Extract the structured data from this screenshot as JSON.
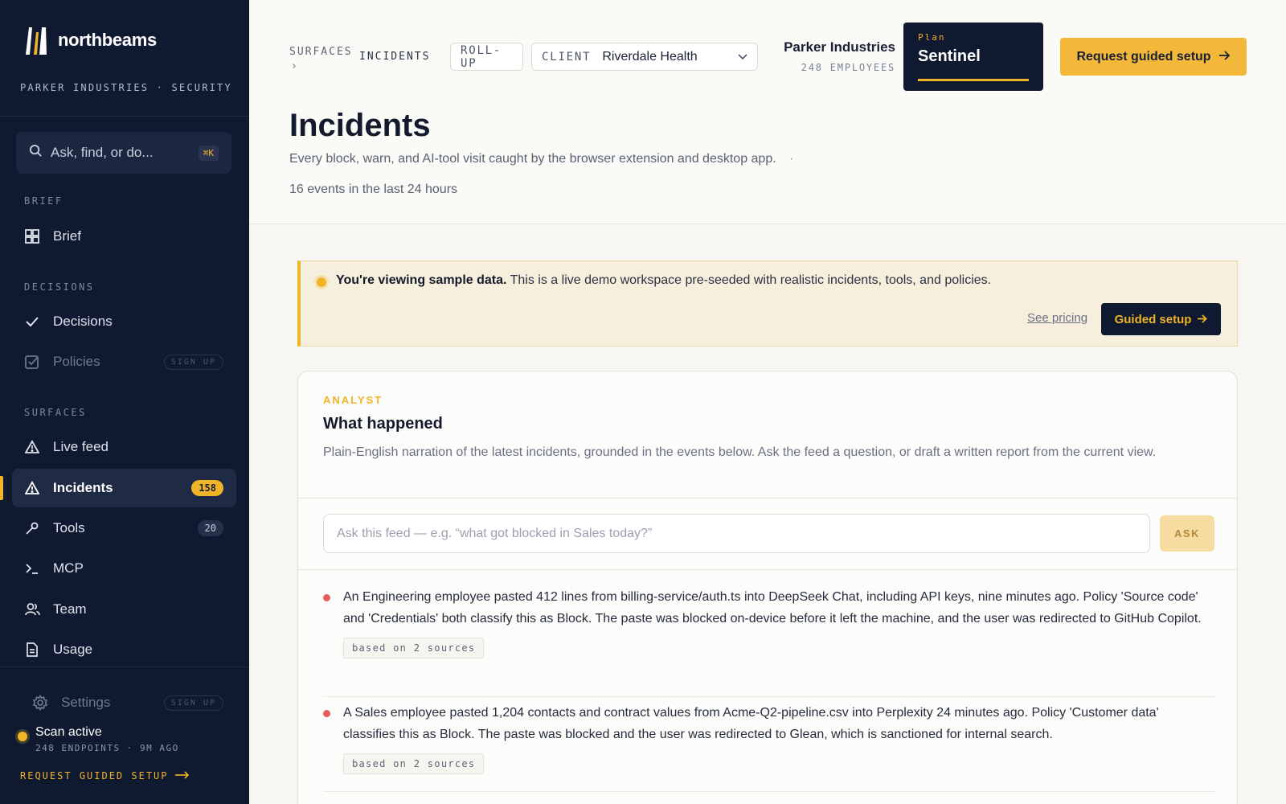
{
  "sidebar": {
    "brand": "northbeams",
    "org_line": "PARKER INDUSTRIES · SECURITY",
    "search_placeholder": "Ask, find, or do...",
    "search_shortcut": "⌘K",
    "sections": {
      "brief": "BRIEF",
      "decisions": "DECISIONS",
      "surfaces": "SURFACES"
    },
    "items": {
      "brief": "Brief",
      "decisions": "Decisions",
      "policies": "Policies",
      "policies_tag": "SIGN UP",
      "live_feed": "Live feed",
      "incidents": "Incidents",
      "incidents_count": "158",
      "tools": "Tools",
      "tools_count": "20",
      "mcp": "MCP",
      "team": "Team",
      "usage": "Usage",
      "settings": "Settings",
      "settings_tag": "SIGN UP"
    },
    "scan": {
      "title": "Scan active",
      "meta": "248 ENDPOINTS · 9M AGO"
    },
    "request_link": "REQUEST GUIDED SETUP"
  },
  "header": {
    "breadcrumb_root": "SURFACES",
    "breadcrumb_sep": "›",
    "breadcrumb_current": "INCIDENTS",
    "rollup": "ROLL-UP",
    "client_label": "CLIENT",
    "client_value": "Riverdale Health",
    "org_name": "Parker Industries",
    "org_employees": "248 EMPLOYEES",
    "plan_label": "Plan",
    "plan_name": "Sentinel",
    "cta": "Request guided setup",
    "title": "Incidents",
    "description": "Every block, warn, and AI-tool visit caught by the browser extension and desktop app.",
    "desc_dot": "·",
    "count_text": "16 events in the last 24 hours"
  },
  "banner": {
    "bold": "You're viewing sample data.",
    "text": " This is a live demo workspace pre-seeded with realistic incidents, tools, and policies.",
    "see_pricing": "See pricing",
    "guided_setup": "Guided setup"
  },
  "analyst": {
    "eyebrow": "ANALYST",
    "title": "What happened",
    "description": "Plain-English narration of the latest incidents, grounded in the events below. Ask the feed a question, or draft a written report from the current view.",
    "ask_placeholder": "Ask this feed — e.g. “what got blocked in Sales today?”",
    "ask_button": "ASK",
    "items": [
      {
        "text": "An Engineering employee pasted 412 lines from billing-service/auth.ts into DeepSeek Chat, including API keys, nine minutes ago. Policy 'Source code' and 'Credentials' both classify this as Block. The paste was blocked on-device before it left the machine, and the user was redirected to GitHub Copilot.",
        "sources": "based on 2 sources"
      },
      {
        "text": "A Sales employee pasted 1,204 contacts and contract values from Acme-Q2-pipeline.csv into Perplexity 24 minutes ago. Policy 'Customer data' classifies this as Block. The paste was blocked and the user was redirected to Glean, which is sanctioned for internal search.",
        "sources": "based on 2 sources"
      }
    ]
  },
  "colors": {
    "sidebar_bg": "#0f1930",
    "accent": "#f0b429",
    "danger_dot": "#e35d5b",
    "page_bg": "#f7f6f2"
  }
}
